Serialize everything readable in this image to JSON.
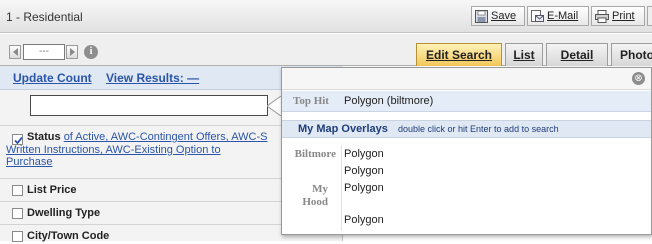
{
  "window": {
    "title": "1 - Residential"
  },
  "toolbar": {
    "save": "Save",
    "email": "E-Mail",
    "print": "Print"
  },
  "pager": {
    "field_value": "---"
  },
  "tabs": [
    {
      "label": "Edit Search",
      "active": true
    },
    {
      "label": "List"
    },
    {
      "label": "Detail"
    },
    {
      "label": "Photo"
    }
  ],
  "actions": {
    "update_count": "Update Count",
    "view_results": "View Results: —"
  },
  "criteria": {
    "status": {
      "label": "Status",
      "checked": true,
      "value_line1": "of Active, AWC-Contingent Offers, AWC-S",
      "value_line2": "Written Instructions, AWC-Existing Option to",
      "value_line3": "Purchase"
    },
    "list_price": "List Price",
    "dwelling_type": "Dwelling Type",
    "city_town": "City/Town Code"
  },
  "popup": {
    "close_glyph": "⊗",
    "top_hit": {
      "label": "Top Hit",
      "value": "Polygon  (biltmore)"
    },
    "overlays": {
      "heading": "My Map Overlays",
      "hint": "double click or hit Enter to add to search",
      "groups": [
        {
          "name": "Biltmore",
          "items": [
            "Polygon",
            "Polygon"
          ]
        },
        {
          "name": "My Hood",
          "items": [
            "Polygon",
            "Polygon"
          ]
        }
      ]
    }
  },
  "colors": {
    "accent_tab": "#f2c75a",
    "link": "#2a55a8",
    "panel_blue": "#dfe8f3"
  }
}
